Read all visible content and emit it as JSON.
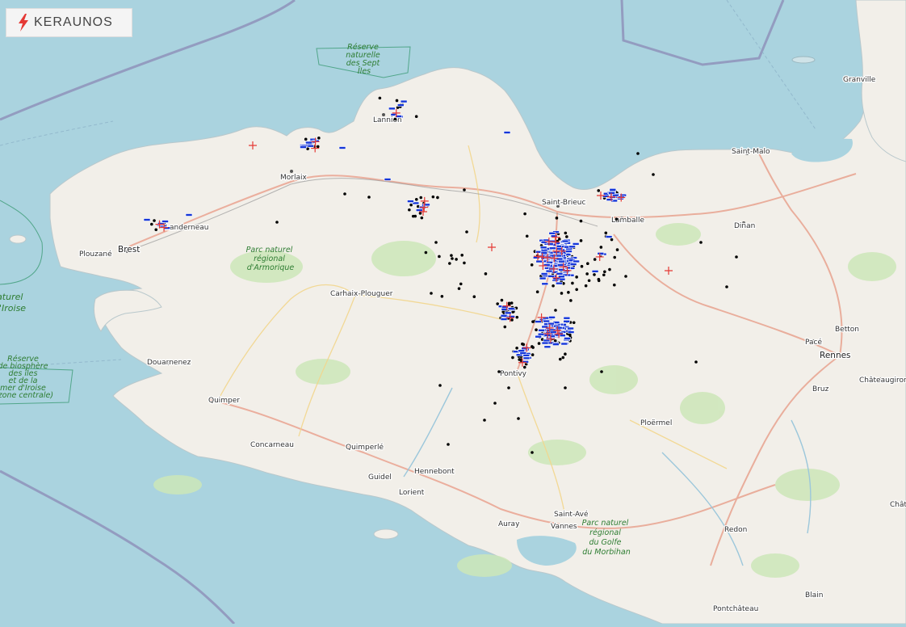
{
  "brand": {
    "name": "KERAUNOS",
    "icon": "lightning-bolt-icon",
    "accent": "#e53935"
  },
  "map": {
    "colors": {
      "sea": "#aad3df",
      "land": "#f2efe9",
      "forest": "#cde6b8",
      "park_text": "#2e7d32",
      "cg_positive": "#e53935",
      "cg_negative": "#1536d8",
      "intracloud": "#000000"
    },
    "towns": [
      {
        "label": "Brest",
        "big": true
      },
      {
        "label": "Plouzané",
        "big": false
      },
      {
        "label": "Landerneau",
        "big": false
      },
      {
        "label": "Morlaix",
        "big": false
      },
      {
        "label": "Lannion",
        "big": false
      },
      {
        "label": "Saint-Brieuc",
        "big": false
      },
      {
        "label": "Lamballe",
        "big": false
      },
      {
        "label": "Dinan",
        "big": false
      },
      {
        "label": "Saint-Malo",
        "big": false
      },
      {
        "label": "Granville",
        "big": false
      },
      {
        "label": "Carhaix-Plouguer",
        "big": false
      },
      {
        "label": "Douarnenez",
        "big": false
      },
      {
        "label": "Quimper",
        "big": false
      },
      {
        "label": "Concarneau",
        "big": false
      },
      {
        "label": "Quimperlé",
        "big": false
      },
      {
        "label": "Hennebont",
        "big": false
      },
      {
        "label": "Guidel",
        "big": false
      },
      {
        "label": "Lorient",
        "big": false
      },
      {
        "label": "Pontivy",
        "big": false
      },
      {
        "label": "Ploërmel",
        "big": false
      },
      {
        "label": "Saint-Avé",
        "big": false
      },
      {
        "label": "Auray",
        "big": false
      },
      {
        "label": "Vannes",
        "big": false
      },
      {
        "label": "Redon",
        "big": false
      },
      {
        "label": "Pacé",
        "big": false
      },
      {
        "label": "Rennes",
        "big": true
      },
      {
        "label": "Betton",
        "big": false
      },
      {
        "label": "Châteaugiron",
        "big": false
      },
      {
        "label": "Bruz",
        "big": false
      },
      {
        "label": "Blain",
        "big": false
      },
      {
        "label": "Pontchâteau",
        "big": false
      },
      {
        "label": "Chât",
        "big": false
      }
    ],
    "parks": [
      {
        "lines": [
          "Réserve",
          "naturelle",
          "des Sept",
          "Îles"
        ],
        "big": false
      },
      {
        "lines": [
          "Parc naturel",
          "régional",
          "d'Armorique"
        ],
        "big": false
      },
      {
        "lines": [
          "aturel",
          "l'Iroise"
        ],
        "big": true
      },
      {
        "lines": [
          "Réserve",
          "de biosphère",
          "des îles",
          "et de la",
          "mer d'Iroise",
          "(zone centrale)"
        ],
        "big": false
      },
      {
        "lines": [
          "Parc naturel",
          "régional",
          "du Golfe",
          "du Morbihan"
        ],
        "big": false
      }
    ]
  }
}
